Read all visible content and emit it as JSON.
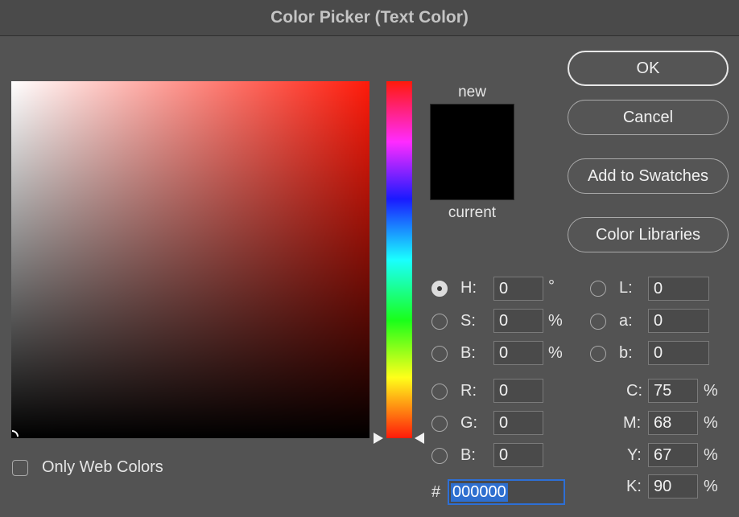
{
  "window": {
    "title": "Color Picker (Text Color)"
  },
  "preview": {
    "new_label": "new",
    "current_label": "current",
    "new_color": "#000000",
    "current_color": "#000000"
  },
  "buttons": {
    "ok": "OK",
    "cancel": "Cancel",
    "add_to_swatches": "Add to Swatches",
    "color_libraries": "Color Libraries"
  },
  "hsb": {
    "h": {
      "label": "H:",
      "value": "0",
      "unit": "°",
      "selected": true
    },
    "s": {
      "label": "S:",
      "value": "0",
      "unit": "%"
    },
    "b": {
      "label": "B:",
      "value": "0",
      "unit": "%"
    }
  },
  "lab": {
    "l": {
      "label": "L:",
      "value": "0"
    },
    "a": {
      "label": "a:",
      "value": "0"
    },
    "b": {
      "label": "b:",
      "value": "0"
    }
  },
  "rgb": {
    "r": {
      "label": "R:",
      "value": "0"
    },
    "g": {
      "label": "G:",
      "value": "0"
    },
    "b": {
      "label": "B:",
      "value": "0"
    }
  },
  "cmyk": {
    "c": {
      "label": "C:",
      "value": "75",
      "unit": "%"
    },
    "m": {
      "label": "M:",
      "value": "68",
      "unit": "%"
    },
    "y": {
      "label": "Y:",
      "value": "67",
      "unit": "%"
    },
    "k": {
      "label": "K:",
      "value": "90",
      "unit": "%"
    }
  },
  "hex": {
    "label": "#",
    "value": "000000"
  },
  "only_web_colors": {
    "label": "Only Web Colors",
    "checked": false
  },
  "colors": {
    "accent": "#2e6fcf",
    "hue_base": "#ff1a0a"
  }
}
